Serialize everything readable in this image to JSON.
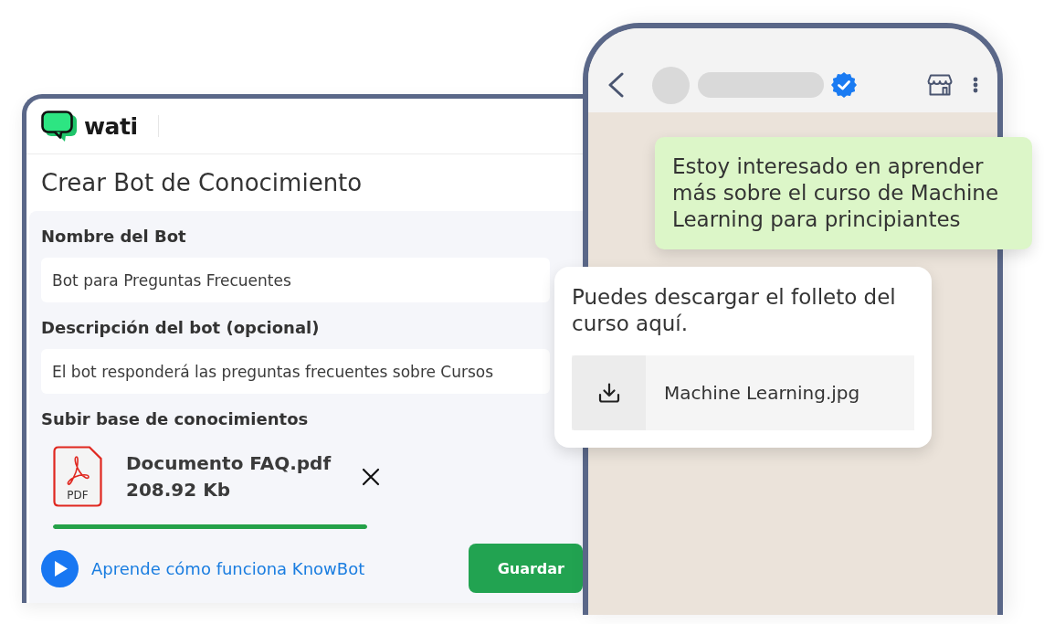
{
  "app_window": {
    "brand": "wati",
    "title": "Crear Bot de Conocimiento",
    "fields": [
      {
        "label": "Nombre del Bot",
        "value": "Bot para Preguntas Frecuentes"
      },
      {
        "label": "Descripción del bot (opcional)",
        "value": "El bot responderá las preguntas frecuentes sobre Cursos"
      }
    ],
    "upload": {
      "label": "Subir base de conocimientos",
      "file": {
        "type_label": "PDF",
        "name": "Documento FAQ.pdf",
        "size": "208.92 Kb",
        "level": 1
      }
    },
    "help_link": "Aprende cómo funciona KnowBot",
    "save_button": "Guardar"
  },
  "phone": {
    "header": {
      "verified": true
    },
    "messages": [
      {
        "kind": "sent",
        "text": "Estoy interesado en aprender más sobre el curso de Machine Learning para principiantes"
      },
      {
        "kind": "received",
        "text": "Puedes descargar el folleto del curso aquí.",
        "attachment": {
          "name": "Machine Learning.jpg"
        }
      }
    ]
  }
}
